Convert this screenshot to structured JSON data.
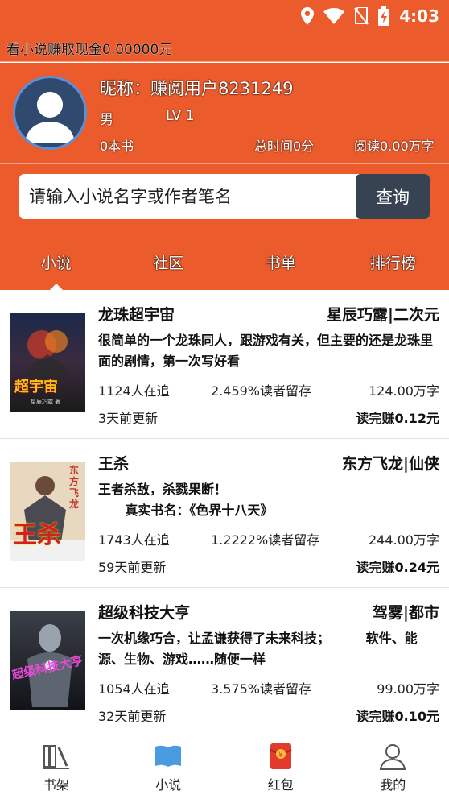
{
  "status_bar": {
    "time": "4:03",
    "icons": [
      "location-icon",
      "wifi-icon",
      "no-sim-icon",
      "battery-charging-icon"
    ]
  },
  "earn_banner": {
    "text": "看小说赚取现金0.00000元"
  },
  "profile": {
    "nickname": "昵称：赚阅用户8231249",
    "gender": "男",
    "level": "LV 1",
    "books_count": "0本书",
    "total_time": "总时间0分",
    "read_amount": "阅读0.00万字",
    "avatar_icon": "default-avatar-icon"
  },
  "search": {
    "placeholder": "请输入小说名字或作者笔名",
    "button_label": "查询"
  },
  "tabs": [
    {
      "label": "小说",
      "active": true
    },
    {
      "label": "社区",
      "active": false
    },
    {
      "label": "书单",
      "active": false
    },
    {
      "label": "排行榜",
      "active": false
    }
  ],
  "books": [
    {
      "title": "龙珠超宇宙",
      "author_genre": "星辰巧露|二次元",
      "description": "很简单的一个龙珠同人，跟游戏有关，但主要的还是龙珠里面的剧情，第一次写好看",
      "followers": "1124人在追",
      "retention": "2.459%读者留存",
      "words": "124.00万字",
      "updated": "3天前更新",
      "earn": "读完赚0.12元",
      "cover_text": "超宇宙",
      "cover_author": "星辰巧露 著"
    },
    {
      "title": "王杀",
      "author_genre": "东方飞龙|仙侠",
      "description": "王者杀敌，杀戮果断！\n      真实书名：《色界十八天》",
      "followers": "1743人在追",
      "retention": "1.2222%读者留存",
      "words": "244.00万字",
      "updated": "59天前更新",
      "earn": "读完赚0.24元",
      "cover_text": "王杀",
      "cover_author": "东方飞龙"
    },
    {
      "title": "超级科技大亨",
      "author_genre": "驾雾|都市",
      "description": "一次机缘巧合，让孟谦获得了未来科技；        软件、能源、生物、游戏……随便一样",
      "followers": "1054人在追",
      "retention": "3.575%读者留存",
      "words": "99.00万字",
      "updated": "32天前更新",
      "earn": "读完赚0.10元",
      "cover_text": "超级科技大亨"
    }
  ],
  "bottom_nav": [
    {
      "label": "书架",
      "icon": "bookshelf-icon",
      "active": false
    },
    {
      "label": "小说",
      "icon": "open-book-icon",
      "active": true
    },
    {
      "label": "红包",
      "icon": "red-packet-icon",
      "active": false
    },
    {
      "label": "我的",
      "icon": "user-icon",
      "active": false
    }
  ],
  "colors": {
    "accent": "#ec5b2c",
    "search_button": "#374253",
    "nav_active": "#4a9be0"
  }
}
